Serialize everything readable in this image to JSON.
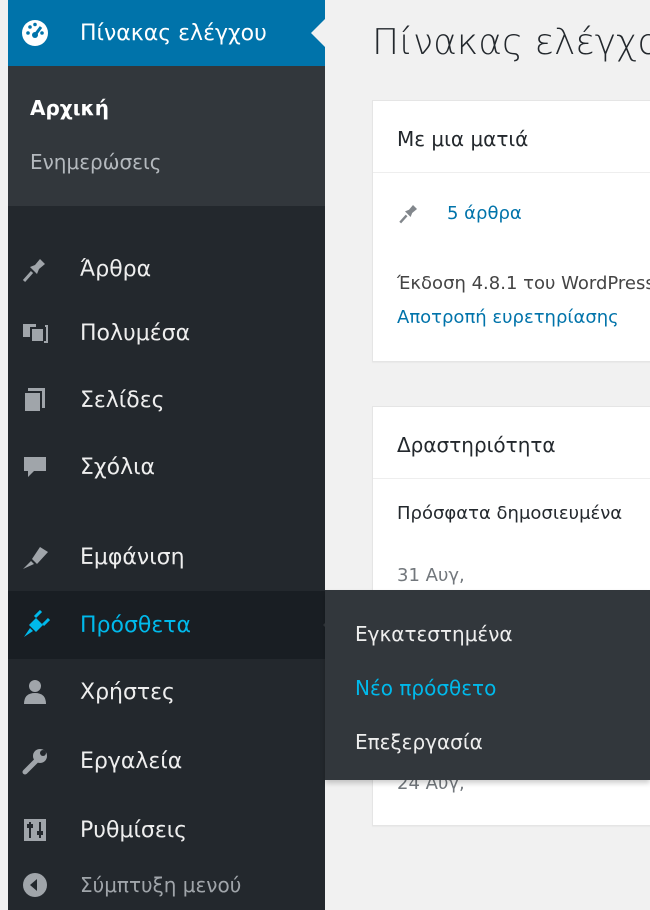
{
  "sidebar": {
    "dashboard": {
      "label": "Πίνακας ελέγχου",
      "icon": "dashboard-icon"
    },
    "dashboard_submenu": [
      {
        "label": "Αρχική",
        "current": true
      },
      {
        "label": "Ενημερώσεις",
        "current": false
      }
    ],
    "items": [
      {
        "label": "Άρθρα",
        "icon": "pushpin-icon"
      },
      {
        "label": "Πολυμέσα",
        "icon": "media-icon"
      },
      {
        "label": "Σελίδες",
        "icon": "pages-icon"
      },
      {
        "label": "Σχόλια",
        "icon": "comments-icon"
      },
      {
        "label": "Εμφάνιση",
        "icon": "paintbrush-icon"
      },
      {
        "label": "Πρόσθετα",
        "icon": "plugins-icon"
      },
      {
        "label": "Χρήστες",
        "icon": "users-icon"
      },
      {
        "label": "Εργαλεία",
        "icon": "wrench-icon"
      },
      {
        "label": "Ρυθμίσεις",
        "icon": "settings-icon"
      }
    ],
    "collapse": {
      "label": "Σύμπτυξη μενού",
      "icon": "collapse-arrow-icon"
    }
  },
  "plugins_flyout": [
    {
      "label": "Εγκατεστημένα",
      "active": false
    },
    {
      "label": "Νέο πρόσθετο",
      "active": true
    },
    {
      "label": "Επεξεργασία",
      "active": false
    }
  ],
  "main": {
    "page_title": "Πίνακας ελέγχου",
    "at_a_glance": {
      "title": "Με μια ματιά",
      "posts_link": "5 άρθρα",
      "version_text": "Έκδοση 4.8.1 του WordPress",
      "search_engines_link": "Αποτροπή ευρετηρίασης"
    },
    "activity": {
      "title": "Δραστηριότητα",
      "recently_published": "Πρόσφατα δημοσιευμένα",
      "dates": [
        "31 Αυγ,",
        "24 Αυγ,"
      ]
    }
  },
  "colors": {
    "sidebar_bg": "#23282d",
    "submenu_bg": "#32373c",
    "active_item_bg": "#0073aa",
    "highlight_text": "#00b9eb",
    "link": "#0073aa"
  }
}
